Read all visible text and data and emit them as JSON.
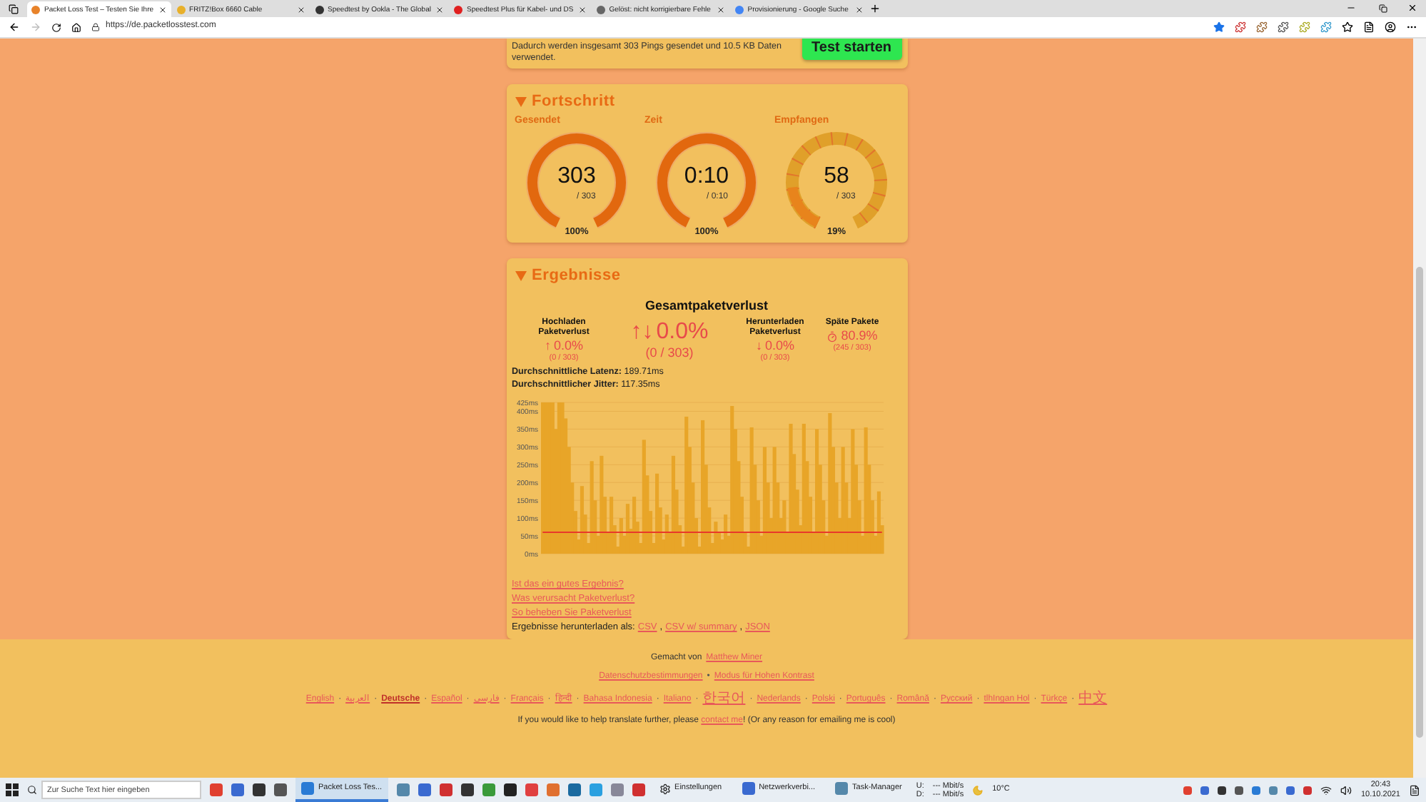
{
  "browser": {
    "tabs": [
      {
        "title": "Packet Loss Test – Testen Sie Ihre",
        "selected": true
      },
      {
        "title": "FRITZ!Box 6660 Cable",
        "selected": false
      },
      {
        "title": "Speedtest by Ookla - The Global",
        "selected": false
      },
      {
        "title": "Speedtest Plus für Kabel- und DS",
        "selected": false
      },
      {
        "title": "Gelöst: nicht korrigierbare Fehle",
        "selected": false
      },
      {
        "title": "Provisionierung - Google Suche",
        "selected": false
      }
    ],
    "url": "https://de.packetlosstest.com"
  },
  "intro": {
    "text": "Dadurch werden insgesamt 303 Pings gesendet und 10.5 KB Daten verwendet.",
    "button": "Test starten"
  },
  "progress": {
    "title": "Fortschritt",
    "expanded": true,
    "gauges": [
      {
        "label": "Gesendet",
        "value": "303",
        "total": "/ 303",
        "percent": "100%",
        "level": 1,
        "kind": "solid"
      },
      {
        "label": "Zeit",
        "value": "0:10",
        "total": "/ 0:10",
        "percent": "100%",
        "level": 1,
        "kind": "solid"
      },
      {
        "label": "Empfangen",
        "value": "58",
        "total": "/ 303",
        "percent": "19%",
        "level": 0.19,
        "kind": "dashed"
      }
    ]
  },
  "results": {
    "title": "Ergebnisse",
    "expanded": true,
    "total": {
      "heading": "Gesamtpaketverlust",
      "arrow": "↑↓",
      "value": "0.0%",
      "count": "(0 / 303)"
    },
    "columns": [
      {
        "heading": "Hochladen Paketverlust",
        "kind": "arrow",
        "icon": "↑",
        "value": "0.0%",
        "count": "(0 / 303)"
      },
      {
        "heading": "Herunterladen Paketverlust",
        "kind": "arrow",
        "icon": "↓",
        "value": "0.0%",
        "count": "(0 / 303)"
      },
      {
        "heading": "Späte Pakete",
        "kind": "timer",
        "value": "80.9%",
        "count": "(245 / 303)"
      }
    ],
    "stats": [
      "**Durchschnittliche Latenz:** 189.71ms",
      "**Durchschnittlicher Jitter:** 117.35ms"
    ],
    "chart_data": {
      "type": "bar",
      "ylim": [
        0,
        425
      ],
      "yticks": [
        {
          "value": 0,
          "label": "0ms"
        },
        {
          "value": 50,
          "label": "50ms"
        },
        {
          "value": 100,
          "label": "100ms"
        },
        {
          "value": 150,
          "label": "150ms"
        },
        {
          "value": 200,
          "label": "200ms"
        },
        {
          "value": 250,
          "label": "250ms"
        },
        {
          "value": 300,
          "label": "300ms"
        },
        {
          "value": 350,
          "label": "350ms"
        },
        {
          "value": 400,
          "label": "400ms"
        },
        {
          "value": 425,
          "label": "425ms"
        }
      ],
      "grid": true,
      "series": [
        {
          "color": "#e8a528",
          "values": [
            425,
            425,
            425,
            425,
            350,
            425,
            425,
            380,
            300,
            200,
            120,
            40,
            190,
            110,
            30,
            260,
            150,
            50,
            275,
            160,
            60,
            160,
            80,
            20,
            100,
            50,
            140,
            70,
            160,
            90,
            30,
            320,
            220,
            120,
            30,
            225,
            130,
            40,
            110,
            60,
            275,
            180,
            80,
            20,
            385,
            300,
            200,
            100,
            20,
            375,
            250,
            130,
            30,
            90,
            60,
            40,
            110,
            50,
            415,
            350,
            260,
            160,
            60,
            20,
            355,
            250,
            150,
            50,
            300,
            200,
            100,
            300,
            200,
            100,
            150,
            60,
            365,
            280,
            180,
            80,
            365,
            260,
            160,
            60,
            350,
            250,
            150,
            50,
            395,
            300,
            200,
            100,
            300,
            200,
            100,
            350,
            250,
            150,
            50,
            355,
            250,
            150,
            50,
            175,
            80
          ]
        },
        {
          "color": "#e8382a",
          "type": "line",
          "values": [
            60,
            60,
            60,
            60,
            60,
            60,
            60,
            60,
            60,
            60,
            60,
            60,
            60,
            60,
            60,
            60,
            60,
            60,
            60,
            60,
            60,
            60,
            60,
            60,
            60,
            60,
            60,
            60,
            60,
            60,
            60,
            60,
            60,
            60,
            60,
            60,
            60,
            60,
            60,
            60,
            60,
            60,
            60,
            60,
            60,
            60,
            60,
            60,
            60,
            60,
            60,
            60,
            60,
            60,
            60,
            60,
            60,
            60,
            60,
            60,
            60,
            60,
            60,
            60,
            60,
            60,
            60,
            60,
            60,
            60,
            60,
            60,
            60,
            60,
            60,
            60,
            60,
            60,
            60,
            60,
            60,
            60,
            60,
            60,
            60,
            60,
            60,
            60,
            60,
            60,
            60,
            60,
            60,
            60,
            60,
            60,
            60,
            60,
            60,
            60,
            60,
            60,
            60,
            60,
            60
          ]
        }
      ]
    },
    "links": [
      "Ist das ein gutes Ergebnis?",
      "Was verursacht Paketverlust?",
      "So beheben Sie Paketverlust"
    ],
    "download": {
      "label": "Ergebnisse herunterladen als:",
      "separator": ",",
      "links": [
        "CSV",
        "CSV w/ summary",
        "JSON"
      ]
    }
  },
  "footer": {
    "made_by": "Gemacht von",
    "author": "Matthew Miner",
    "policy_links": [
      "Datenschutzbestimmungen",
      "Modus für Hohen Kontrast"
    ],
    "policy_separator": "•",
    "languages": [
      {
        "label": "English",
        "selected": false
      },
      {
        "label": "العربية",
        "selected": false
      },
      {
        "label": "Deutsche",
        "selected": true
      },
      {
        "label": "Español",
        "selected": false
      },
      {
        "label": "فارسی",
        "selected": false
      },
      {
        "label": "Français",
        "selected": false
      },
      {
        "label": "हिन्दी",
        "selected": false
      },
      {
        "label": "Bahasa Indonesia",
        "selected": false
      },
      {
        "label": "Italiano",
        "selected": false
      },
      {
        "label": "한국어",
        "selected": false
      },
      {
        "label": "Nederlands",
        "selected": false
      },
      {
        "label": "Polski",
        "selected": false
      },
      {
        "label": "Português",
        "selected": false
      },
      {
        "label": "Română",
        "selected": false
      },
      {
        "label": "Русский",
        "selected": false
      },
      {
        "label": "tlhIngan Hol",
        "selected": false
      },
      {
        "label": "Türkçe",
        "selected": false
      },
      {
        "label": "中文",
        "selected": false
      }
    ],
    "language_separator": "·",
    "translate": {
      "before": "If you would like to help translate further, please",
      "link": "contact me",
      "after": "! (Or any reason for emailing me is cool)"
    }
  },
  "taskbar": {
    "search_placeholder": "Zur Suche Text hier eingeben",
    "apps": [
      {
        "label": "Packet Loss Tes...",
        "selected": true
      },
      {
        "label": "Einstellungen",
        "selected": false
      },
      {
        "label": "Netzwerkverbi...",
        "selected": false
      },
      {
        "label": "Task-Manager",
        "selected": false
      }
    ],
    "net": [
      {
        "label": "U:",
        "value": "--- Mbit/s"
      },
      {
        "label": "D:",
        "value": "--- Mbit/s"
      }
    ],
    "weather": "10°C",
    "time": "20:43",
    "date": "10.10.2021"
  }
}
